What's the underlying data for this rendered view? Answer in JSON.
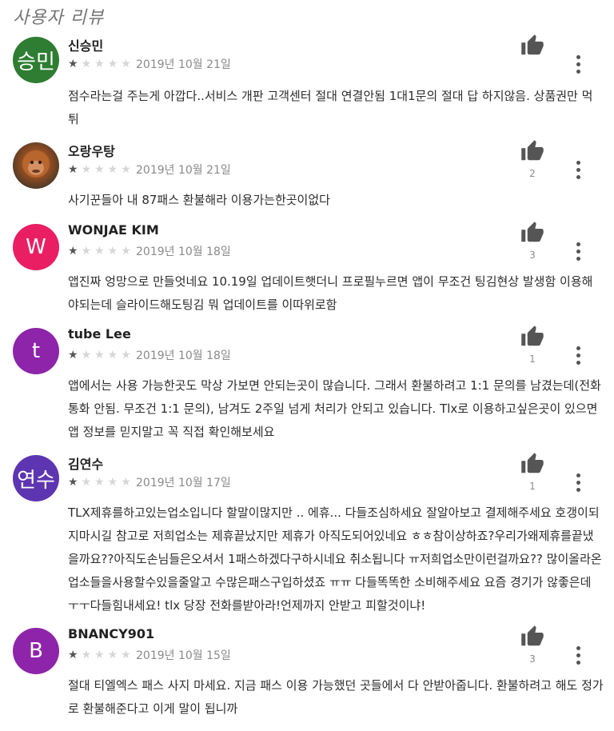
{
  "section": {
    "title": "사용자 리뷰"
  },
  "reviews": [
    {
      "initials": "승민",
      "name": "신승민",
      "color": "#2e7d32",
      "rating": 1,
      "date": "2019년 10월 21일",
      "likes": "",
      "text": "점수라는걸 주는게 아깝다..서비스 개판 고객센터 절대 연결안됨 1대1문의 절대 답 하지않음. 상품권만 먹튀"
    },
    {
      "initials": "",
      "name": "오랑우탕",
      "color": "#8a4a22",
      "rating": 1,
      "date": "2019년 10월 21일",
      "likes": "2",
      "text": "사기꾼들아 내 87패스 환불해라 이용가는한곳이없다"
    },
    {
      "initials": "W",
      "name": "WONJAE KIM",
      "color": "#e91e63",
      "rating": 1,
      "date": "2019년 10월 18일",
      "likes": "3",
      "text": "앱진짜 엉망으로 만들엇네요 10.19일 업데이트햇더니 프로필누르면 앱이 무조건 팅김현상 발생함 이용해야되는데 슬라이드해도팅김 뭐 업데이트를 이따위로함"
    },
    {
      "initials": "t",
      "name": "tube Lee",
      "color": "#8e24aa",
      "rating": 1,
      "date": "2019년 10월 18일",
      "likes": "1",
      "text": "앱에서는 사용 가능한곳도 막상 가보면 안되는곳이 많습니다. 그래서 환불하려고 1:1 문의를 남겼는데(전화통화 안됨. 무조건 1:1 문의), 남겨도 2주일 넘게 처리가 안되고 있습니다. Tlx로 이용하고싶은곳이 있으면 앱 정보를 믿지말고 꼭 직접 확인해보세요"
    },
    {
      "initials": "연수",
      "name": "김연수",
      "color": "#5e35b1",
      "rating": 1,
      "date": "2019년 10월 17일",
      "likes": "1",
      "text": "TLX제휴를하고있는업소입니다 할말이많지만 .. 에휴... 다들조심하세요 잘알아보고 결제해주세요 호갱이되지마시길 참고로 저희업소는 제휴끝났지만 제휴가 아직도되어있네요 ㅎㅎ참이상하죠?우리가왜제휴를끝냈을까요??아직도손님들은오셔서 1패스하겠다구하시네요 취소됩니다 ㅠ저희업소만이런걸까요?? 많이올라온업소들을사용할수있을줄알고 수많은패스구입하셨죠 ㅠㅠ 다들똑똑한 소비해주세요 요즘 경기가 않좋은데 ㅜㅜ다들힘내세요! tlx 당장 전화를받아라!언제까지 안받고 피할것이냐!"
    },
    {
      "initials": "B",
      "name": "BNANCY901",
      "color": "#8e24aa",
      "rating": 1,
      "date": "2019년 10월 15일",
      "likes": "3",
      "text": "절대 티엘엑스 패스 사지 마세요. 지금 패스 이용 가능했던 곳들에서 다 안받아줍니다. 환불하려고 해도 정가로 환불해준다고 이게 말이 됩니까"
    }
  ]
}
